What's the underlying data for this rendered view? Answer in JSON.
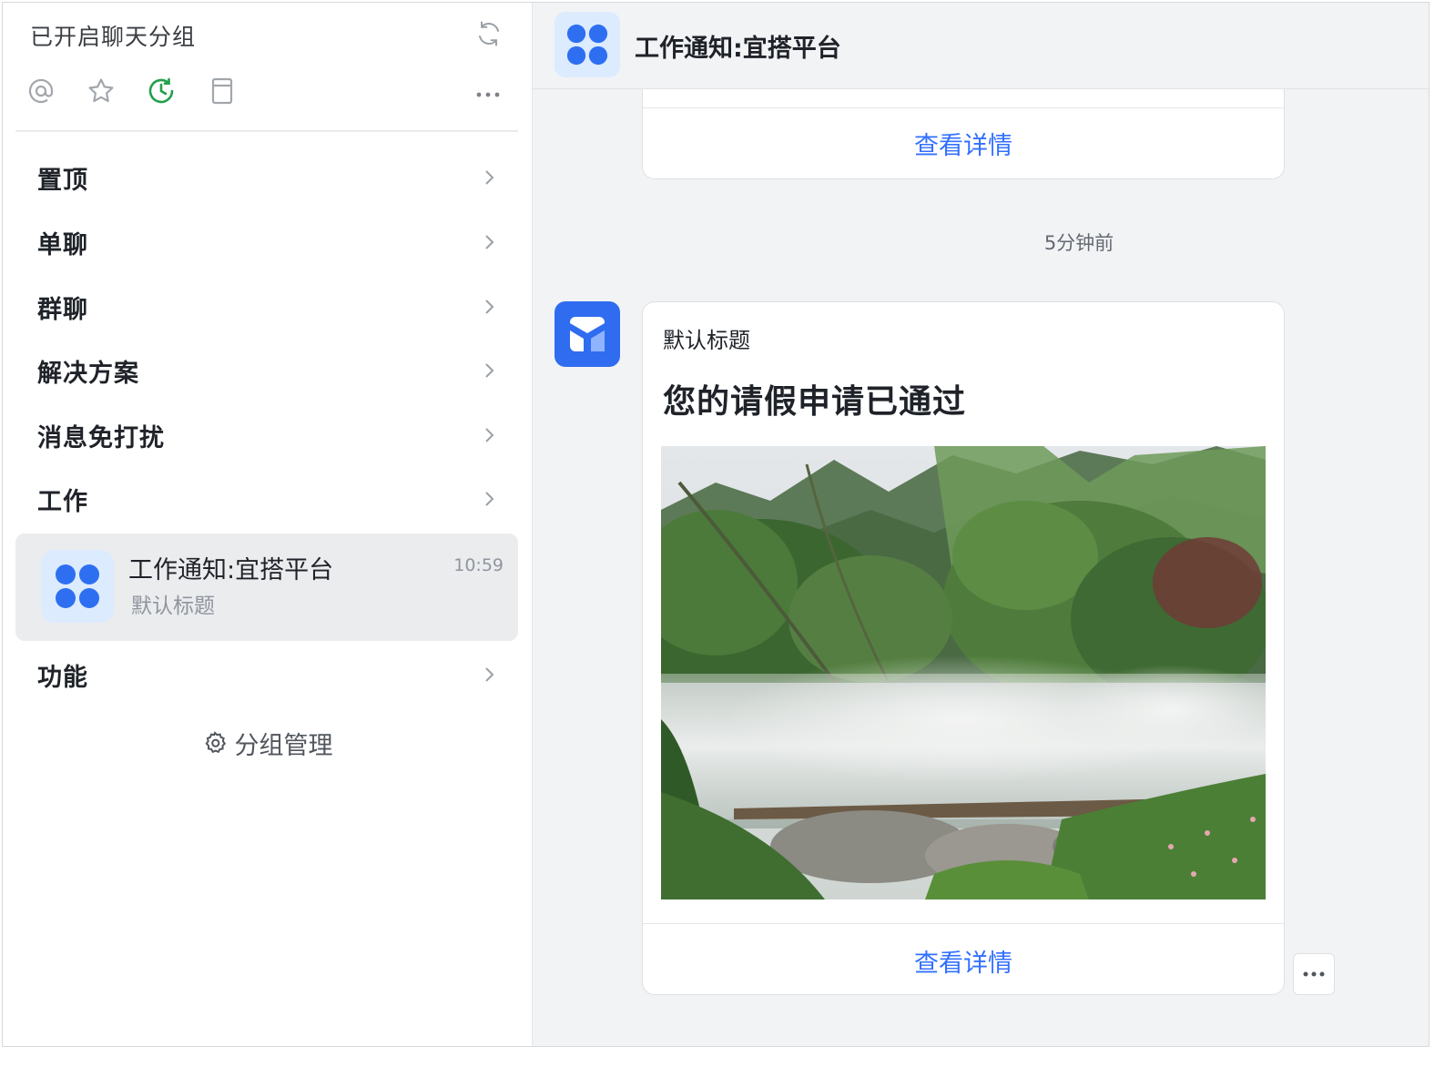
{
  "sidebar": {
    "title": "已开启聊天分组",
    "icons": [
      "refresh-icon",
      "at-icon",
      "star-icon",
      "clock-icon",
      "clipboard-icon",
      "more-icon"
    ],
    "groups": [
      {
        "label": "置顶"
      },
      {
        "label": "单聊"
      },
      {
        "label": "群聊"
      },
      {
        "label": "解决方案"
      },
      {
        "label": "消息免打扰"
      },
      {
        "label": "工作"
      }
    ],
    "active_chat": {
      "name": "工作通知:宜搭平台",
      "subtitle": "默认标题",
      "time": "10:59"
    },
    "groups_after": [
      {
        "label": "功能"
      }
    ],
    "manage_label": "分组管理"
  },
  "chat": {
    "title": "工作通知:宜搭平台",
    "top_card_link": "查看详情",
    "timestamp": "5分钟前",
    "message": {
      "label": "默认标题",
      "headline": "您的请假申请已通过",
      "link": "查看详情"
    }
  },
  "colors": {
    "accent": "#3370ff",
    "active_green": "#22a04b",
    "avatar_bg": "#dcebfd",
    "bot_blue": "#2f6cf0",
    "selected_bg": "#ebecee",
    "chat_bg": "#f2f3f5"
  }
}
